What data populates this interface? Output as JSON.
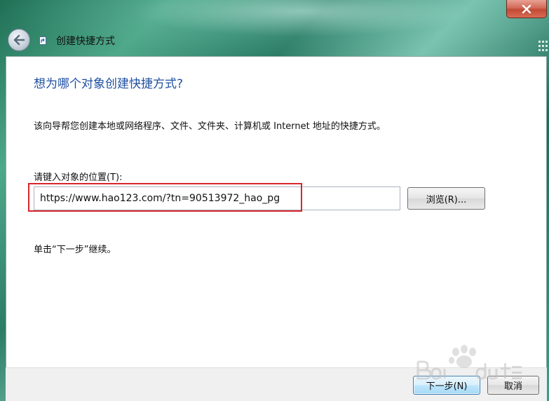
{
  "window": {
    "title": "创建快捷方式",
    "close_icon": "close-icon",
    "back_icon": "back-arrow-icon"
  },
  "content": {
    "heading": "想为哪个对象创建快捷方式?",
    "description": "该向导帮您创建本地或网络程序、文件、文件夹、计算机或 Internet 地址的快捷方式。",
    "location_label": "请键入对象的位置(T):",
    "location_value": "https://www.hao123.com/?tn=90513972_hao_pg",
    "browse_label": "浏览(R)...",
    "hint": "单击“下一步”继续。"
  },
  "footer": {
    "next_label": "下一步(N)",
    "cancel_label": "取消"
  },
  "colors": {
    "heading": "#1e4fa0",
    "highlight": "#d7262b",
    "close_button": "#c24a34"
  }
}
